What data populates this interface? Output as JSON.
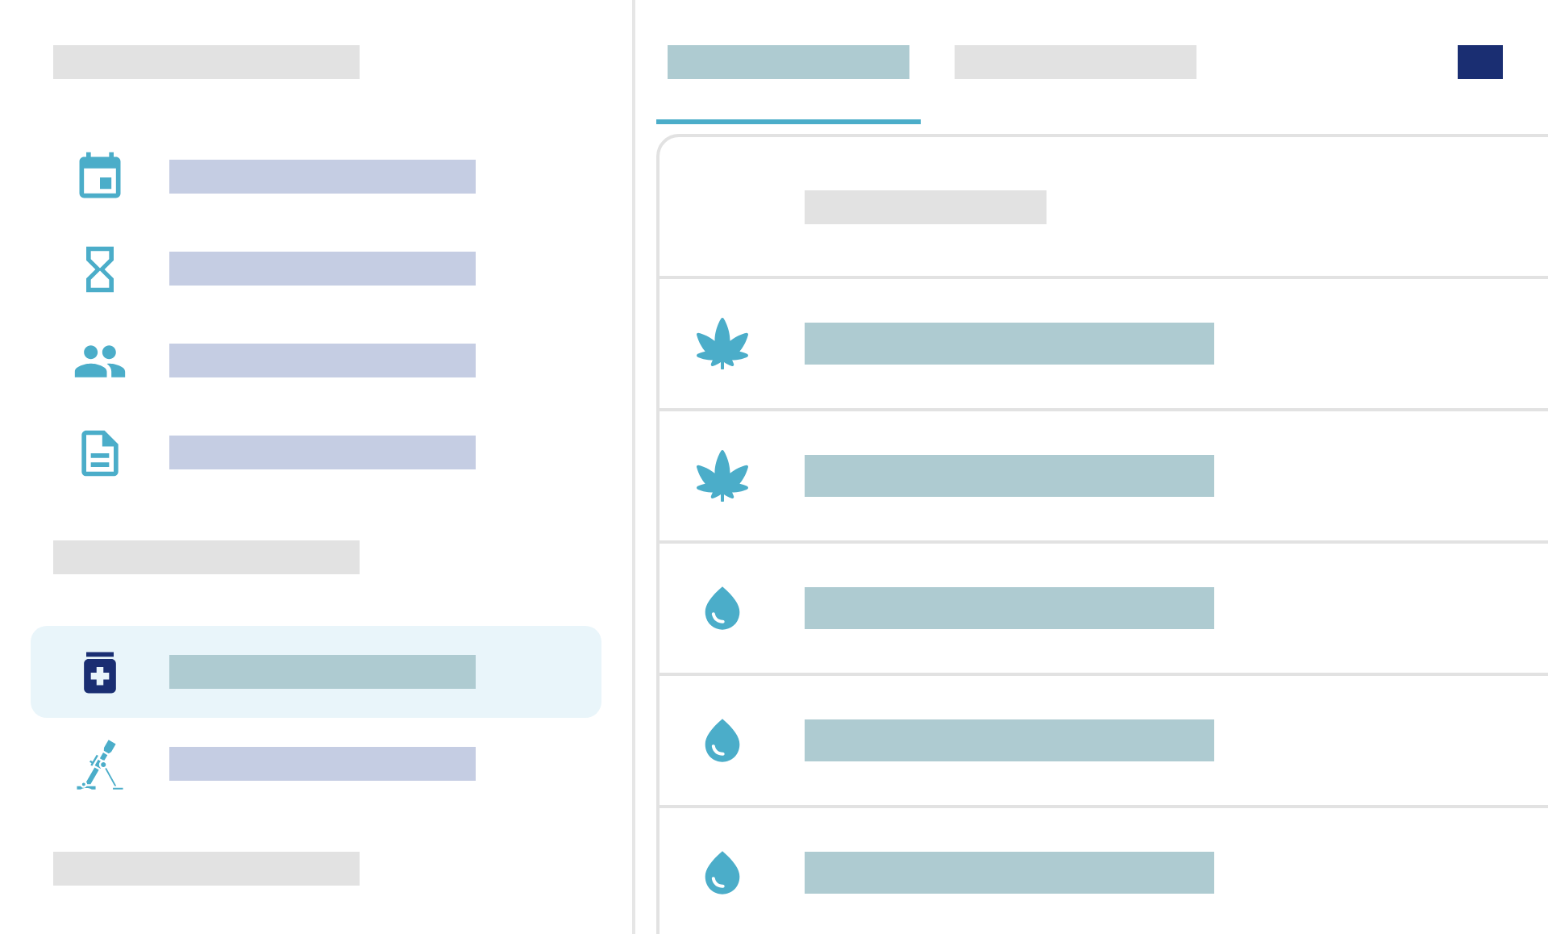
{
  "sidebar": {
    "sections": [
      {
        "kind": "section",
        "items": [
          {
            "kind": "calendar",
            "selected": false
          },
          {
            "kind": "hourglass",
            "selected": false
          },
          {
            "kind": "people",
            "selected": false
          },
          {
            "kind": "document",
            "selected": false
          }
        ]
      },
      {
        "kind": "section",
        "items": [
          {
            "kind": "medication",
            "selected": true
          },
          {
            "kind": "mortar",
            "selected": false
          }
        ]
      },
      {
        "kind": "section"
      }
    ]
  },
  "tabs": [
    {
      "selected": true
    },
    {
      "selected": false
    }
  ],
  "table": {
    "rows": [
      {
        "kind": "leaf"
      },
      {
        "kind": "leaf"
      },
      {
        "kind": "drop"
      },
      {
        "kind": "drop"
      },
      {
        "kind": "drop"
      }
    ]
  }
}
